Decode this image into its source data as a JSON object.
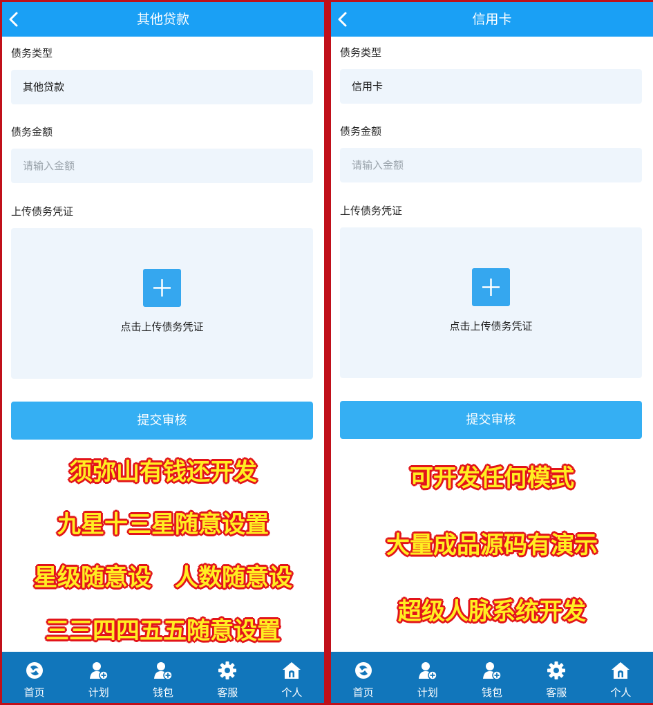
{
  "left": {
    "title": "其他贷款",
    "type_label": "债务类型",
    "type_value": "其他贷款",
    "amount_label": "债务金额",
    "amount_placeholder": "请输入金额",
    "upload_label": "上传债务凭证",
    "upload_hint": "点击上传债务凭证",
    "submit": "提交审核",
    "promo": [
      "须弥山有钱还开发",
      "九星十三星随意设置",
      "星级随意设　人数随意设",
      "三三四四五五随意设置"
    ]
  },
  "right": {
    "title": "信用卡",
    "type_label": "债务类型",
    "type_value": "信用卡",
    "amount_label": "债务金额",
    "amount_placeholder": "请输入金额",
    "upload_label": "上传债务凭证",
    "upload_hint": "点击上传债务凭证",
    "submit": "提交审核",
    "promo": [
      "可开发任何模式",
      "大量成品源码有演示",
      "超级人脉系统开发"
    ]
  },
  "tabs": [
    {
      "label": "首页",
      "icon": "home-orb-icon"
    },
    {
      "label": "计划",
      "icon": "user-plus-icon"
    },
    {
      "label": "钱包",
      "icon": "user-plus-icon"
    },
    {
      "label": "客服",
      "icon": "gear-icon"
    },
    {
      "label": "个人",
      "icon": "house-icon"
    }
  ],
  "colors": {
    "header": "#1aa0f5",
    "tabbar": "#1176bb",
    "button": "#35aff3",
    "field_bg": "#eef5fc",
    "frame": "#c0101a",
    "promo_fill": "#ffee22",
    "promo_outline": "#e2141a"
  }
}
